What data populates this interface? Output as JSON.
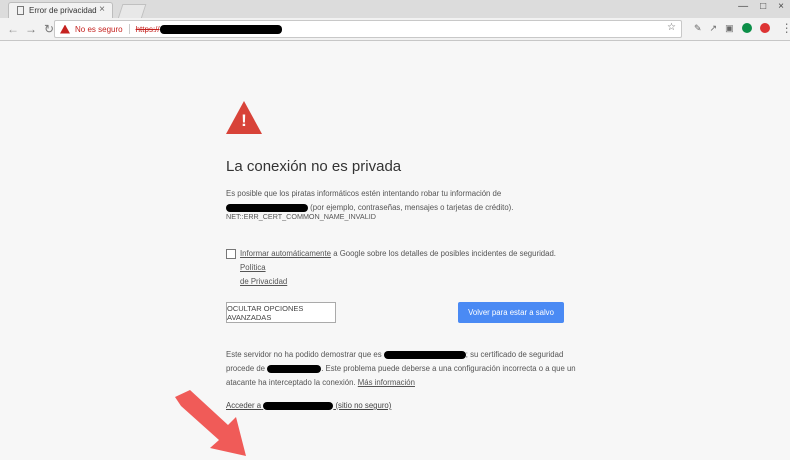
{
  "browser": {
    "tab_title": "Error de privacidad",
    "tab_close": "×",
    "not_secure": "No es seguro",
    "protocol": "https://",
    "icons": [
      "back-icon",
      "forward-icon",
      "reload-icon",
      "star-icon",
      "menu-icon"
    ]
  },
  "page": {
    "title": "La conexión no es privada",
    "description_before": "Es posible que los piratas informáticos estén intentando robar tu información de",
    "description_after": "(por ejemplo, contraseñas, mensajes o tarjetas de crédito).",
    "error_code": "NET::ERR_CERT_COMMON_NAME_INVALID",
    "report_link": "Informar automáticamente",
    "report_text": "a Google sobre los detalles de posibles incidentes de seguridad.",
    "privacy_link_1": "Política",
    "privacy_link_2": "de Privacidad",
    "advanced_button": "OCULTAR OPCIONES AVANZADAS",
    "safe_button": "Volver para estar a salvo",
    "details_1": "Este servidor no ha podido demostrar que es",
    "details_2": "; su certificado de seguridad procede de",
    "details_3": ". Este problema puede deberse a una configuración incorrecta o a que un atacante ha interceptado la conexión.",
    "more_info": "Más información",
    "proceed_prefix": "Acceder a",
    "proceed_suffix": "(sitio no seguro)"
  }
}
